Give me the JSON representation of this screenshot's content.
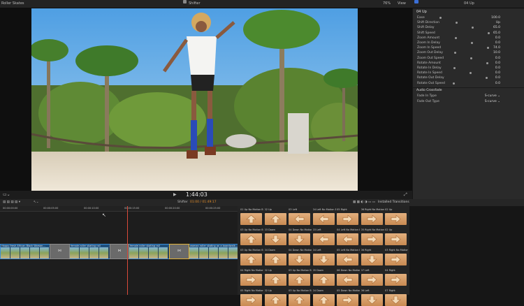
{
  "topbar": {
    "library": "Roller Skates",
    "project": "Shifter",
    "zoom": "76%",
    "view": "View",
    "inspector_title": "04 Up"
  },
  "viewer": {
    "timecode": "1:44:03"
  },
  "inspector": {
    "section_title": "04 Up",
    "params": [
      {
        "label": "Ease",
        "value": "100.0"
      },
      {
        "label": "Shift Direction",
        "value": "Up"
      },
      {
        "label": "Shift Delay",
        "value": "65.0"
      },
      {
        "label": "Shift Speed",
        "value": "65.0"
      },
      {
        "label": "Zoom Amount",
        "value": "0.0"
      },
      {
        "label": "Zoom In Delay",
        "value": "0.0"
      },
      {
        "label": "Zoom In Speed",
        "value": "74.0"
      },
      {
        "label": "Zoom Out Delay",
        "value": "10.0"
      },
      {
        "label": "Zoom Out Speed",
        "value": "0.0"
      },
      {
        "label": "Rotate Amount",
        "value": "0.0"
      },
      {
        "label": "Rotate In Delay",
        "value": "0.0"
      },
      {
        "label": "Rotate In Speed",
        "value": "0.0"
      },
      {
        "label": "Rotate Out Delay",
        "value": "0.0"
      },
      {
        "label": "Rotate Out Speed",
        "value": "0.0"
      }
    ],
    "crossfade_title": "Audio Crossfade",
    "crossfade": [
      {
        "label": "Fade In Type",
        "value": "S-curve"
      },
      {
        "label": "Fade Out Type",
        "value": "S-curve"
      }
    ]
  },
  "timeline": {
    "project": "Shifter",
    "position": "01:00 / 01:49:17",
    "ruler_ticks": [
      "00:00:00:00",
      "00:00:05:00",
      "00:00:10:00",
      "00:00:15:00",
      "00:00:20:00",
      "00:00:25:00",
      "00:00:30:00"
    ],
    "clips": [
      {
        "label": "Happy fresh African Black Woman..."
      },
      {
        "label": "female roller skating rail"
      },
      {
        "label": "female roller skating rail"
      },
      {
        "label": "woman roller skating on a boardwalk..."
      }
    ],
    "transition_marker": "⋈"
  },
  "browser": {
    "header": "Installed Transitions",
    "tiles": [
      {
        "label": "01 Up No Motion Blur",
        "dir": "up"
      },
      {
        "label": "02 Up",
        "dir": "up"
      },
      {
        "label": "03 Left",
        "dir": "left"
      },
      {
        "label": "04 Left No Motion Blur",
        "dir": "left"
      },
      {
        "label": "05 Right",
        "dir": "right"
      },
      {
        "label": "06 Right No Motion Blur",
        "dir": "right"
      },
      {
        "label": "02 Up",
        "dir": "right"
      },
      {
        "label": "03 Up No Motion Blur",
        "dir": "up"
      },
      {
        "label": "03 Down",
        "dir": "down"
      },
      {
        "label": "04 Down No Motion Blur",
        "dir": "down"
      },
      {
        "label": "03 Left",
        "dir": "left"
      },
      {
        "label": "04 Left No Motion Blur",
        "dir": "left"
      },
      {
        "label": "05 Right No Motion Blur",
        "dir": "right"
      },
      {
        "label": "02 Up",
        "dir": "right"
      },
      {
        "label": "03 Up No Motion Blur",
        "dir": "up"
      },
      {
        "label": "04 Down",
        "dir": "up"
      },
      {
        "label": "04 Down No Motion Blur",
        "dir": "down"
      },
      {
        "label": "04 Left",
        "dir": "down"
      },
      {
        "label": "05 Left No Motion Blur",
        "dir": "left"
      },
      {
        "label": "06 Right",
        "dir": "down"
      },
      {
        "label": "03 Right No Motion Blur",
        "dir": "right"
      },
      {
        "label": "04 Right No Motion Blur",
        "dir": "right"
      },
      {
        "label": "02 Up",
        "dir": "up"
      },
      {
        "label": "03 Up No Motion Blur",
        "dir": "up"
      },
      {
        "label": "05 Down",
        "dir": "up"
      },
      {
        "label": "06 Down No Motion Blur",
        "dir": "left"
      },
      {
        "label": "07 Left",
        "dir": "right"
      },
      {
        "label": "04 Right",
        "dir": "right"
      },
      {
        "label": "05 Right No Motion Blur",
        "dir": "right"
      },
      {
        "label": "02 Up",
        "dir": "up"
      },
      {
        "label": "03 Up No Motion Blur",
        "dir": "up"
      },
      {
        "label": "04 Down",
        "dir": "up"
      },
      {
        "label": "05 Down No Motion Blur",
        "dir": "right"
      },
      {
        "label": "06 Left",
        "dir": "down"
      },
      {
        "label": "07 Right",
        "dir": "down"
      }
    ]
  },
  "colors": {
    "accent": "#3b6fd6",
    "clip": "#3c8fd8",
    "playhead": "#d84a3a",
    "tile": "#d9a06a"
  }
}
